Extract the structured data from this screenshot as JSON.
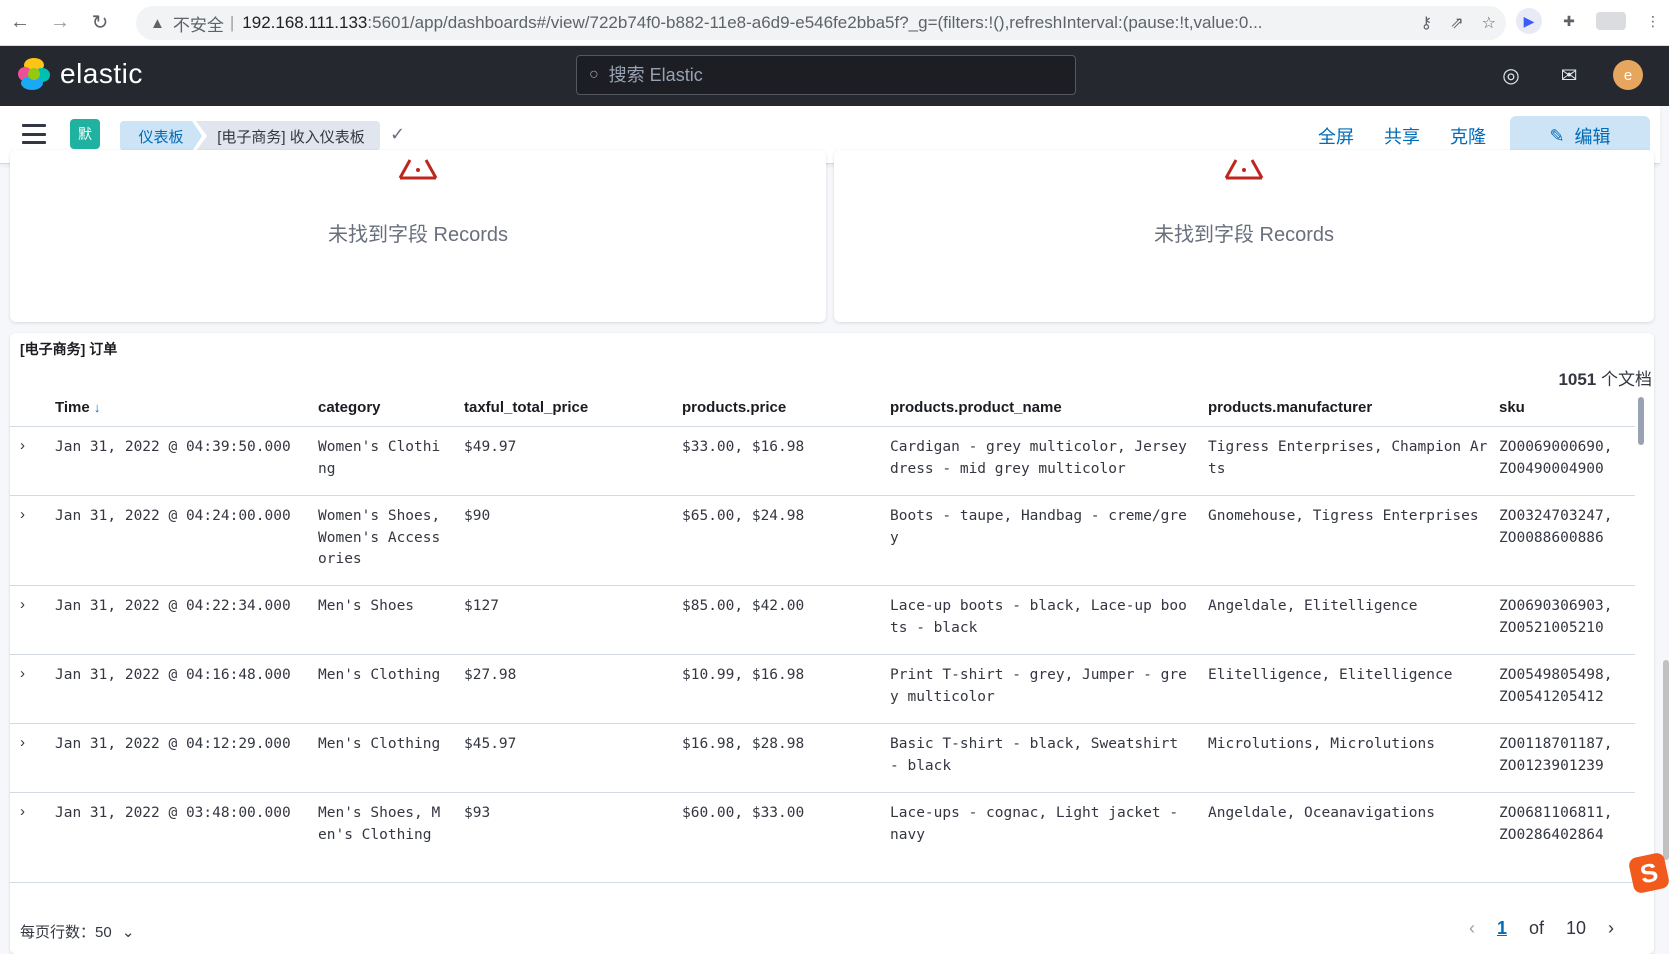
{
  "browser": {
    "insecure_label": "不安全",
    "url_host": "192.168.111.133",
    "url_path": ":5601/app/dashboards#/view/722b74f0-b882-11e8-a6d9-e546fe2bba5f?_g=(filters:!(),refreshInterval:(pause:!t,value:0..."
  },
  "header": {
    "logo_text": "elastic",
    "search_placeholder": "搜索 Elastic",
    "avatar_letter": "e"
  },
  "breadcrumb": {
    "space_badge": "默",
    "items": [
      "仪表板",
      "[电子商务] 收入仪表板"
    ]
  },
  "actions": {
    "fullscreen": "全屏",
    "share": "共享",
    "clone": "克隆",
    "edit": "编辑"
  },
  "error_panels": [
    {
      "message": "未找到字段 Records"
    },
    {
      "message": "未找到字段 Records"
    }
  ],
  "orders_panel": {
    "title": "[电子商务] 订单",
    "doc_count_number": "1051",
    "doc_count_suffix": " 个文档",
    "columns": [
      "Time",
      "category",
      "taxful_total_price",
      "products.price",
      "products.product_name",
      "products.manufacturer",
      "sku"
    ],
    "rows": [
      {
        "time": "Jan 31, 2022 @ 04:39:50.000",
        "category": "Women's Clothing",
        "total": "$49.97",
        "price": "$33.00, $16.98",
        "product": "Cardigan - grey multicolor, Jersey dress - mid grey multicolor",
        "manufacturer": "Tigress Enterprises, Champion Arts",
        "sku": "ZO0069000690, ZO0490004900"
      },
      {
        "time": "Jan 31, 2022 @ 04:24:00.000",
        "category": "Women's Shoes, Women's Accessories",
        "total": "$90",
        "price": "$65.00, $24.98",
        "product": "Boots - taupe, Handbag - creme/grey",
        "manufacturer": "Gnomehouse, Tigress Enterprises",
        "sku": "ZO0324703247, ZO0088600886"
      },
      {
        "time": "Jan 31, 2022 @ 04:22:34.000",
        "category": "Men's Shoes",
        "total": "$127",
        "price": "$85.00, $42.00",
        "product": "Lace-up boots - black, Lace-up boots - black",
        "manufacturer": "Angeldale, Elitelligence",
        "sku": "ZO0690306903, ZO0521005210"
      },
      {
        "time": "Jan 31, 2022 @ 04:16:48.000",
        "category": "Men's Clothing",
        "total": "$27.98",
        "price": "$10.99, $16.98",
        "product": "Print T-shirt - grey, Jumper - grey multicolor",
        "manufacturer": "Elitelligence, Elitelligence",
        "sku": "ZO0549805498, ZO0541205412"
      },
      {
        "time": "Jan 31, 2022 @ 04:12:29.000",
        "category": "Men's Clothing",
        "total": "$45.97",
        "price": "$16.98, $28.98",
        "product": "Basic T-shirt - black, Sweatshirt - black",
        "manufacturer": "Microlutions, Microlutions",
        "sku": "ZO0118701187, ZO0123901239"
      },
      {
        "time": "Jan 31, 2022 @ 03:48:00.000",
        "category": "Men's Shoes, Men's Clothing",
        "total": "$93",
        "price": "$60.00, $33.00",
        "product": "Lace-ups - cognac, Light jacket - navy",
        "manufacturer": "Angeldale, Oceanavigations",
        "sku": "ZO0681106811, ZO0286402864"
      }
    ],
    "rows_per_page_label": "每页行数：50",
    "pagination": {
      "current": "1",
      "of": "of",
      "total": "10"
    }
  },
  "colors": {
    "kibana_header": "#25282f",
    "link_blue": "#006bb8",
    "space_badge": "#20b2a0",
    "avatar": "#e7a65d",
    "error_red": "#bd271e"
  },
  "icons": [
    "back-icon",
    "forward-icon",
    "reload-icon",
    "warning-icon",
    "key-icon",
    "share-icon",
    "star-icon",
    "extension-icon",
    "search-icon",
    "help-icon",
    "newsfeed-icon",
    "menu-icon",
    "check-icon",
    "pencil-icon",
    "chevron-right-icon",
    "chevron-down-icon",
    "sort-down-icon"
  ]
}
